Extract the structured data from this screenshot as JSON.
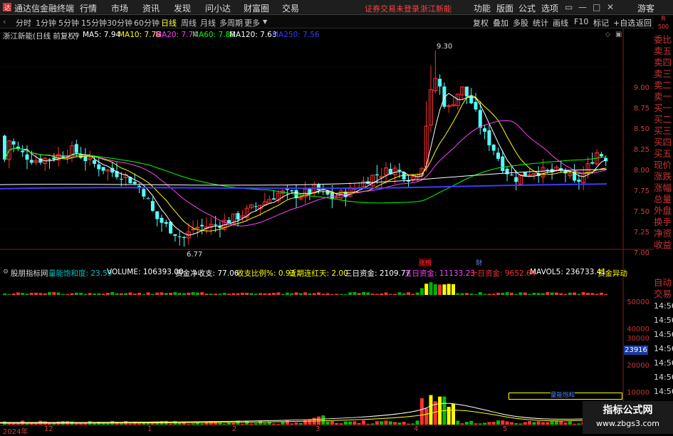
{
  "menubar": {
    "app_title": "通达信金融终端",
    "items": [
      "行情",
      "市场",
      "资讯",
      "发现",
      "问小达",
      "财富圈",
      "交易"
    ],
    "login_status": "证券交易未登录",
    "stock_name": "浙江新能",
    "right_items": [
      "功能",
      "版面",
      "公式",
      "选项"
    ],
    "guest": "游客"
  },
  "periods": [
    "分时",
    "1分钟",
    "5分钟",
    "15分钟",
    "30分钟",
    "60分钟",
    "日线",
    "周线",
    "月线",
    "多周期",
    "更多"
  ],
  "active_period": "日线",
  "tools": [
    "复权",
    "叠加",
    "多股",
    "统计",
    "画线",
    "F10",
    "标记",
    "+自选",
    "返回"
  ],
  "ma_line": {
    "title": "浙江新能(日线 前复权)",
    "items": [
      {
        "label": "MA5: 7.94",
        "color": "#ffffff"
      },
      {
        "label": "MA10: 7.78",
        "color": "#ffff00"
      },
      {
        "label": "MA20: 7.74",
        "color": "#ff40ff"
      },
      {
        "label": "MA60: 7.88",
        "color": "#00ff00"
      },
      {
        "label": "MA120: 7.63",
        "color": "#ffffff"
      },
      {
        "label": "MA250: 7.56",
        "color": "#3b3bff"
      }
    ]
  },
  "price_axis": [
    "9.00",
    "8.75",
    "8.50",
    "8.25",
    "8.00",
    "7.75",
    "7.50",
    "7.25",
    "7.00"
  ],
  "price_high_label": "9.30",
  "price_low_label": "6.77",
  "r_badge": "R",
  "r_value": "500",
  "side_panel": [
    "委比",
    "卖五",
    "卖四",
    "卖三",
    "卖二",
    "卖一",
    "买一",
    "买二",
    "买三",
    "买四",
    "买五",
    "现价",
    "涨跌",
    "涨幅",
    "总量",
    "外盘",
    "换手",
    "净资",
    "收益"
  ],
  "side_panel2": [
    "自动",
    "交易"
  ],
  "side_times": [
    "14:56",
    "14:56",
    "14:56",
    "14:56",
    "14:56",
    "14:56",
    "14:56",
    "14:56",
    "14:56"
  ],
  "markers": {
    "m1": "涨榜",
    "m2": "财"
  },
  "indicator": {
    "name": "股朋指标网",
    "items": [
      {
        "label": "量能饱和度: 23.59",
        "color": "#00c0c0"
      },
      {
        "label": "VOLUME: 106393.00",
        "color": "#ffffff"
      },
      {
        "label": "资金净收支: 77.06",
        "color": "#ffffff"
      },
      {
        "label": "收支比例%: 0.93",
        "color": "#ffff00"
      },
      {
        "label": "近期连红天: 2.00",
        "color": "#ffff00"
      },
      {
        "label": "三日资金: 2109.77",
        "color": "#ffffff"
      },
      {
        "label": "五日资金: 11133.23",
        "color": "#ff40ff"
      },
      {
        "label": "十日资金: 9652.64",
        "color": "#ff3030"
      },
      {
        "label": "MAVOL5: 236733.41",
        "color": "#ffffff"
      },
      {
        "label": "资金异动",
        "color": "#ffff00"
      }
    ]
  },
  "vol_axis": [
    "50000",
    "40000",
    "30000",
    "20000",
    "10000"
  ],
  "vol_badge": "23916",
  "vol_box_label": "量能饱和",
  "dates": [
    "2024年",
    "12",
    "1",
    "2",
    "3",
    "4",
    "5"
  ],
  "watermark": {
    "line1": "指标公式网",
    "line2": "www.zbgs3.com"
  },
  "colors": {
    "up": "#ff3232",
    "down": "#54ffff",
    "ma5": "#ffffff",
    "ma10": "#ffff00",
    "ma20": "#ff40ff",
    "ma60": "#00ff00",
    "ma120": "#ffffff",
    "ma250": "#3b3bff"
  }
}
